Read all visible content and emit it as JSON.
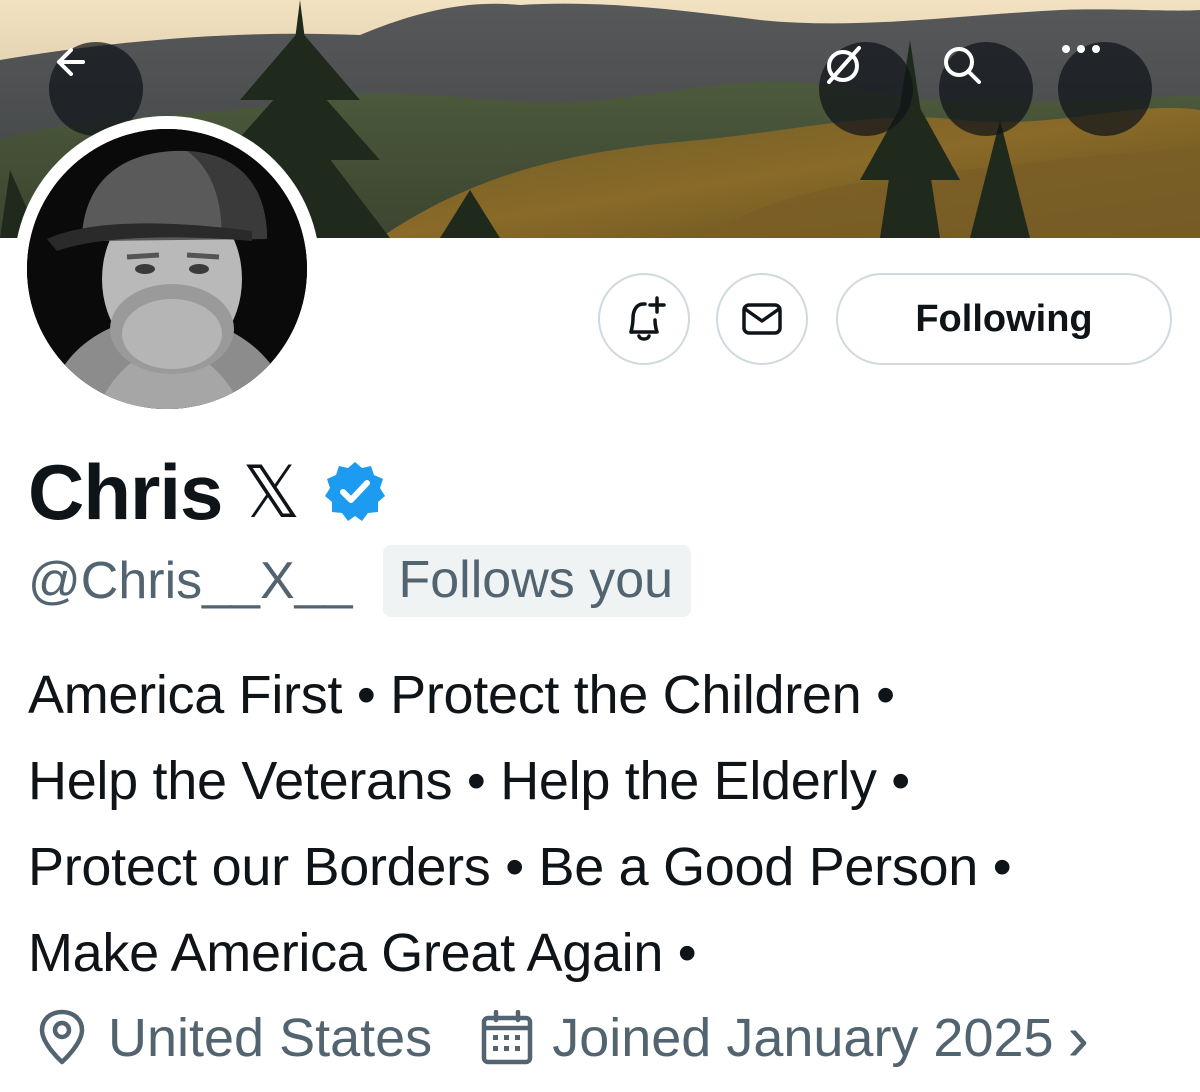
{
  "header": {
    "back_icon": "arrow-left-icon",
    "grok_icon": "grok-icon",
    "search_icon": "search-icon",
    "more_icon": "more-horizontal-icon"
  },
  "profile": {
    "display_name": "Chris",
    "name_suffix": "𝕏",
    "verified_color": "#1d9bf0",
    "handle": "@Chris__X__",
    "follows_you": "Follows you",
    "bio_lines": [
      "America First • Protect the Children •",
      "Help the Veterans • Help the Elderly •",
      "Protect our Borders • Be a Good Person •",
      "Make America Great Again •"
    ],
    "location": "United States",
    "joined": "Joined January 2025",
    "chevron": "›"
  },
  "actions": {
    "notify_icon": "bell-plus-icon",
    "message_icon": "envelope-icon",
    "following_label": "Following"
  },
  "colors": {
    "text_primary": "#0f1419",
    "text_secondary": "#536471",
    "border": "#cfd9de",
    "badge_bg": "#eff3f4"
  }
}
